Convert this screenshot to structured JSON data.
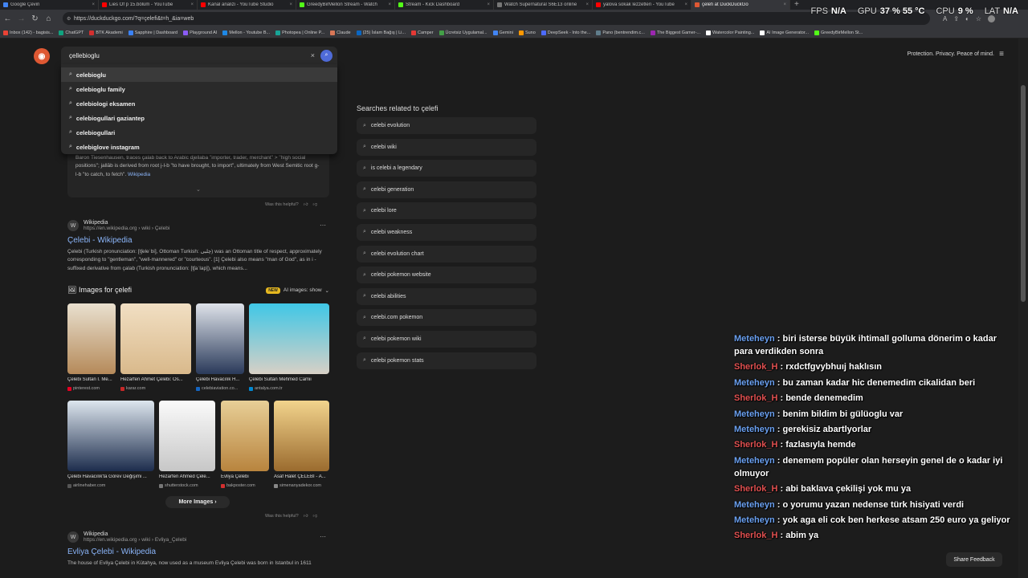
{
  "browser": {
    "tabs": [
      {
        "title": "Google Çeviri",
        "color": "#4285f4",
        "active": false
      },
      {
        "title": "Lies Of p 15.bölüm - YouTube",
        "color": "#ff0000",
        "active": false
      },
      {
        "title": "Kanal analizi - YouTube Studio",
        "color": "#ff0000",
        "active": false
      },
      {
        "title": "GreedyBirMellon Stream - Watch",
        "color": "#53fc18",
        "active": false
      },
      {
        "title": "Stream - Kick Dashboard",
        "color": "#53fc18",
        "active": false
      },
      {
        "title": "Watch Supernatural S6E13 online",
        "color": "#777777",
        "active": false
      },
      {
        "title": "yalova sokak lezzetleri - YouTube",
        "color": "#ff0000",
        "active": false
      },
      {
        "title": "çelefi at DuckDuckGo",
        "color": "#de5833",
        "active": true
      }
    ],
    "url": "https://duckduckgo.com/?q=çelefi&t=h_&ia=web",
    "new_tab": "+",
    "bookmarks": [
      {
        "label": "Inbox (142) - bagisis...",
        "color": "#ea4335"
      },
      {
        "label": "ChatGPT",
        "color": "#10a37f"
      },
      {
        "label": "BTK Akademi",
        "color": "#d32f2f"
      },
      {
        "label": "Sapphire | Dashboard",
        "color": "#3b82f6"
      },
      {
        "label": "Playground AI",
        "color": "#8b5cf6"
      },
      {
        "label": "Mellon - Youtube B...",
        "color": "#1e88e5"
      },
      {
        "label": "Photopea | Online P...",
        "color": "#18a497"
      },
      {
        "label": "Claude",
        "color": "#d97757"
      },
      {
        "label": "(25) İslam Bağış | Li...",
        "color": "#0a66c2"
      },
      {
        "label": "Camper",
        "color": "#e53935"
      },
      {
        "label": "Ücretsiz Uygulamal...",
        "color": "#43a047"
      },
      {
        "label": "Gemini",
        "color": "#4285f4"
      },
      {
        "label": "Suno",
        "color": "#ff9800"
      },
      {
        "label": "DeepSeek - Into the...",
        "color": "#4d6bfe"
      },
      {
        "label": "Pano (bentrendim.c...",
        "color": "#607d8b"
      },
      {
        "label": "The Biggest Gamer-...",
        "color": "#9c27b0"
      },
      {
        "label": "Watercolor Painting...",
        "color": "#ffffff"
      },
      {
        "label": "AI Image Generator...",
        "color": "#ffffff"
      },
      {
        "label": "GreedyBirMellon St...",
        "color": "#53fc18"
      }
    ]
  },
  "overlay": {
    "fps_label": "FPS",
    "fps": "N/A",
    "gpu_label": "GPU",
    "gpu": "37 % 55 °C",
    "cpu_label": "CPU",
    "cpu": "9 %",
    "lat_label": "LAT",
    "lat": "N/A"
  },
  "search": {
    "query": "çellebioglu",
    "clear": "×",
    "suggestions": [
      "celebioglu",
      "celebioglu family",
      "celebiologi eksamen",
      "celebiogullari gaziantep",
      "celebiogullari",
      "celebiglove instagram"
    ]
  },
  "header": {
    "tagline": "Protection. Privacy. Peace of mind."
  },
  "about": {
    "text": "Baron Tiesenhausen, traces çalab back to Arabic djellaba \"importer, trader, merchant\" > \"high social positions\"; jallāb is derived from root j-l-b \"to have brought, to import\", ultimately from West Semitic root g-l-b \"to catch, to fetch\".",
    "link": "Wikipedia"
  },
  "helpful_text": "Was this helpful?",
  "result1": {
    "site": "Wikipedia",
    "url": "https://en.wikipedia.org › wiki › Çelebi",
    "title": "Çelebi - Wikipedia",
    "snippet": "Çelebi (Turkish pronunciation: [tʃeleˈbi], Ottoman Turkish: چلبی) was an Ottoman title of respect, approximately corresponding to \"gentleman\", \"well-mannered\" or \"courteous\". [1] Çelebi also means \"man of God\", as in i -suffixed derivative from çalab (Turkish pronunciation: [tʃaˈlap]), which means..."
  },
  "images": {
    "title": "Images for çelefi",
    "new_badge": "NEW",
    "ai_label": "AI images: show",
    "items": [
      {
        "caption": "Çelebi Sultan I. Me...",
        "source": "pinterest.com",
        "color": "#e60023"
      },
      {
        "caption": "Hezarfen Ahmet Çelebi: Os...",
        "source": "karar.com",
        "color": "#c62828"
      },
      {
        "caption": "Çelebi Havacılık H...",
        "source": "celebiaviation.co...",
        "color": "#1565c0"
      },
      {
        "caption": "Çelebi Sultan Mehmed Camii",
        "source": "antalya.com.tr",
        "color": "#0288d1"
      },
      {
        "caption": "Çelebi Havacılık'ta Görev Değişimi ...",
        "source": "airlinehaber.com",
        "color": "#555555"
      },
      {
        "caption": "Hezarfen Ahmed Çele...",
        "source": "shutterstock.com",
        "color": "#777777"
      },
      {
        "caption": "Evliya Çelebi",
        "source": "bakposter.com",
        "color": "#d32f2f"
      },
      {
        "caption": "Asaf Halet ÇELEBİ - A...",
        "source": "simenanyadekor.com",
        "color": "#888888"
      }
    ],
    "more": "More Images"
  },
  "result2": {
    "site": "Wikipedia",
    "url": "https://en.wikipedia.org › wiki › Evliya_Çelebi",
    "title": "Evliya Çelebi - Wikipedia",
    "snippet": "The house of Evliya Çelebi in Kütahya, now used as a museum Evliya Çelebi was born in Istanbul in 1611"
  },
  "related": {
    "title": "Searches related to çelefi",
    "items": [
      "celebi evolution",
      "celebi wiki",
      "is celebi a legendary",
      "celebi generation",
      "celebi lore",
      "celebi weakness",
      "celebi evolution chart",
      "celebi pokemon website",
      "celebi abilities",
      "celebi.com pokemon",
      "celebi pokemon wiki",
      "celebi pokemon stats"
    ]
  },
  "chat": [
    {
      "user": "Meteheyn",
      "type": 1,
      "text": "biri isterse büyük ihtimall golluma dönerim o kadar para verdikden sonra"
    },
    {
      "user": "Sherlok_H",
      "type": 2,
      "text": "rxdctfgvybhuıj haklısın"
    },
    {
      "user": "Meteheyn",
      "type": 1,
      "text": "bu zaman kadar hic denemedim cikalidan beri"
    },
    {
      "user": "Sherlok_H",
      "type": 2,
      "text": "bende denemedim"
    },
    {
      "user": "Meteheyn",
      "type": 1,
      "text": "benim bildim bi gülüoglu var"
    },
    {
      "user": "Meteheyn",
      "type": 1,
      "text": "gerekisiz abartlyorlar"
    },
    {
      "user": "Sherlok_H",
      "type": 2,
      "text": "fazlasıyla hemde"
    },
    {
      "user": "Meteheyn",
      "type": 1,
      "text": "denemem popüler olan herseyin genel de o kadar iyi olmuyor"
    },
    {
      "user": "Sherlok_H",
      "type": 2,
      "text": "abi baklava çekilişi yok mu ya"
    },
    {
      "user": "Meteheyn",
      "type": 1,
      "text": "o yorumu yazan nedense türk hisiyati verdi"
    },
    {
      "user": "Meteheyn",
      "type": 1,
      "text": "yok aga eli cok ben herkese atsam 250 euro ya geliyor"
    },
    {
      "user": "Sherlok_H",
      "type": 2,
      "text": "abim ya"
    }
  ],
  "feedback": "Share Feedback"
}
